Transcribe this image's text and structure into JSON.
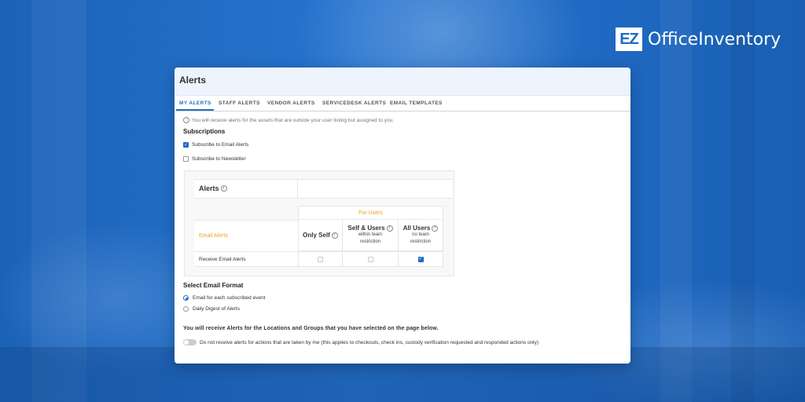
{
  "brand": {
    "logo_mark": "EZ",
    "logo_text": "OfficeInventory"
  },
  "page": {
    "title": "Alerts",
    "tabs": [
      {
        "label": "MY ALERTS",
        "active": true
      },
      {
        "label": "STAFF ALERTS",
        "active": false
      },
      {
        "label": "VENDOR ALERTS",
        "active": false
      },
      {
        "label": "SERVICEDESK ALERTS",
        "active": false
      },
      {
        "label": "EMAIL TEMPLATES",
        "active": false
      }
    ],
    "info_text": "You will receive alerts for the assets that are outside your user listing but assigned to you."
  },
  "subscriptions": {
    "title": "Subscriptions",
    "email_alerts_label": "Subscribe to Email Alerts",
    "email_alerts_checked": true,
    "newsletter_label": "Subscribe to Newsletter",
    "newsletter_checked": false
  },
  "alerts_table": {
    "title": "Alerts",
    "group_header": "For Users",
    "row_header": "Email Alerts",
    "columns": [
      {
        "label": "Only Self",
        "sub": ""
      },
      {
        "label": "Self & Users",
        "sub": "within team restriction"
      },
      {
        "label": "All Users",
        "sub": "no team restriction"
      }
    ],
    "rows": [
      {
        "label": "Receive Email Alerts",
        "values": [
          false,
          false,
          true
        ]
      }
    ]
  },
  "email_format": {
    "title": "Select Email Format",
    "options": [
      {
        "label": "Email for each subscribed event",
        "selected": true
      },
      {
        "label": "Daily Digest of Alerts",
        "selected": false
      }
    ]
  },
  "notice": "You will receive Alerts for the Locations and Groups that you have selected on the page below.",
  "toggle": {
    "label": "Do not receive alerts for actions that are taken by me (this applies to checkouts, check ins, custody verification requested and responded actions only)",
    "on": false
  },
  "colors": {
    "brand_blue": "#1f6bc4",
    "accent_orange": "#f0a020",
    "active_tab": "#2b6cc4"
  },
  "icons": {
    "info": "info-circle-icon",
    "check": "checkmark-icon"
  }
}
